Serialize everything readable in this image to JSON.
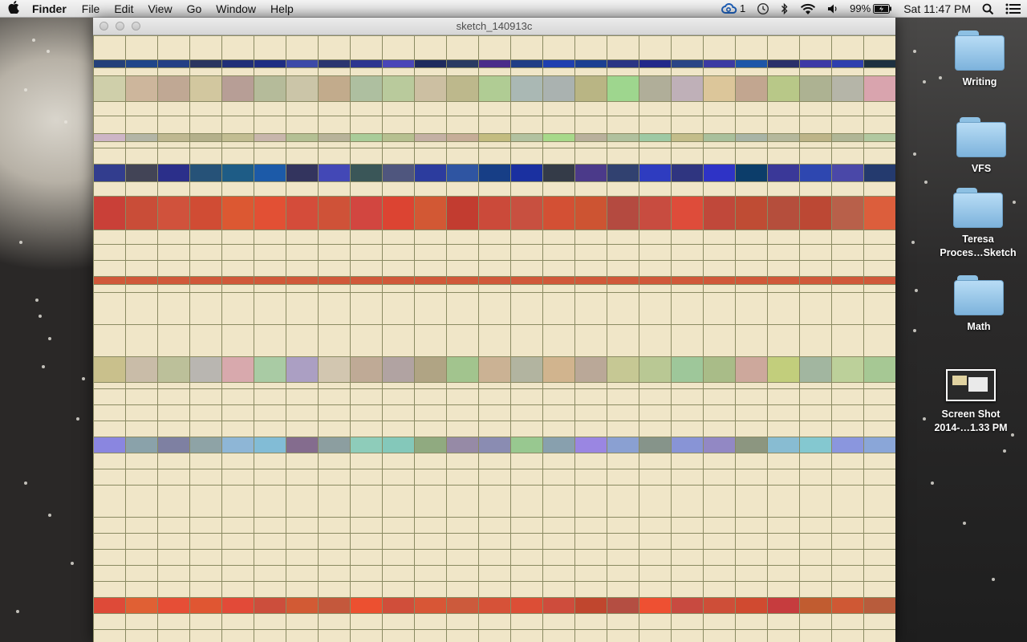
{
  "menubar": {
    "app": "Finder",
    "items": [
      "File",
      "Edit",
      "View",
      "Go",
      "Window",
      "Help"
    ],
    "cc_badge": "1",
    "battery": "99%",
    "clock": "Sat 11:47 PM"
  },
  "window": {
    "title": "sketch_140913c"
  },
  "grid": {
    "color_rows": [
      {
        "colors": [
          "#23407a",
          "#20468a",
          "#243f85",
          "#2a3560",
          "#202e78",
          "#1e2d83",
          "#3d4aa8",
          "#2b3570",
          "#2d3590",
          "#4a46b8",
          "#1e2a5e",
          "#2a3a63",
          "#4a2c8a",
          "#203d86",
          "#1f3fb0",
          "#1c3f92",
          "#2a3584",
          "#22288a",
          "#2a4586",
          "#3b3aa3",
          "#1d56a8",
          "#2a306a",
          "#3d39a6",
          "#2e3fae",
          "#1d3040"
        ]
      },
      {
        "colors": [
          "#cfcfaa",
          "#cdb69c",
          "#c0a894",
          "#d2c79f",
          "#b79e96",
          "#b5bb9a",
          "#cbc5a8",
          "#c2ab8c",
          "#aebfa0",
          "#b9ca9c",
          "#ccbfa2",
          "#bdb88c",
          "#b0cc94",
          "#aab8b4",
          "#aab2b0",
          "#b9b584",
          "#9ed68e",
          "#b0ae99",
          "#bfb0b8",
          "#dcc69a",
          "#c2a690",
          "#b8c888",
          "#adb292",
          "#b5b5a8",
          "#d9a4ae"
        ]
      },
      {
        "colors": [
          "#cdb5c6",
          "#b3b5a6",
          "#bfb891",
          "#b4b08b",
          "#c2bd92",
          "#c8b6ac",
          "#b4c094",
          "#b8b39a",
          "#a9cc99",
          "#b6c090",
          "#c4b0a4",
          "#c6ad98",
          "#c3bc80",
          "#b2c2a0",
          "#a7d98a",
          "#b9b09c",
          "#b0c19e",
          "#9ec9a4",
          "#c3bd8a",
          "#a9c09c",
          "#a8b4a6",
          "#b5b89c",
          "#bdb488",
          "#b0b696",
          "#b1c8a0"
        ]
      },
      {
        "colors": [
          "#323d8e",
          "#424456",
          "#2b2f8a",
          "#265278",
          "#1e5c86",
          "#1c5aa8",
          "#33345e",
          "#4348b6",
          "#3a5658",
          "#4f567e",
          "#2c3c9e",
          "#2f55a2",
          "#173e86",
          "#1a30a0",
          "#343b48",
          "#4b3a8a",
          "#314170",
          "#2e3cc0",
          "#2f3580",
          "#2e33c6",
          "#0c3d6a",
          "#3a3898",
          "#2e47b0",
          "#4a48a8",
          "#243a6e"
        ]
      },
      {
        "colors": [
          "#c94038",
          "#c94d38",
          "#d0523c",
          "#d04c34",
          "#dc5832",
          "#e25034",
          "#d44c3a",
          "#cf5238",
          "#d24640",
          "#dc4432",
          "#d25834",
          "#c23c30",
          "#cb4a3a",
          "#c85040",
          "#d35034",
          "#cd5432",
          "#b44a40",
          "#c84c40",
          "#de4c3a",
          "#c0483a",
          "#bf4c34",
          "#b54e3c",
          "#bc4834",
          "#b8604a",
          "#dc5e3c"
        ]
      },
      {
        "colors": [
          "#d0583a",
          "#d0583a",
          "#d0583a",
          "#d0583a",
          "#d0583a",
          "#d0583a",
          "#d0583a",
          "#d0583a",
          "#d0583a",
          "#d0583a",
          "#d0583a",
          "#d0583a",
          "#d0583a",
          "#d0583a",
          "#d0583a",
          "#d0583a",
          "#d0583a",
          "#d0583a",
          "#d0583a",
          "#d0583a",
          "#d0583a",
          "#d0583a",
          "#d0583a",
          "#d0583a",
          "#d0583a"
        ]
      },
      {
        "colors": [
          "#c9c08c",
          "#c9bca8",
          "#bcc09a",
          "#b9b6b1",
          "#d8a9ad",
          "#a9cba4",
          "#ab9fc3",
          "#d2c6b0",
          "#bfaa96",
          "#b1a3a2",
          "#b0a484",
          "#a2c48e",
          "#cbb294",
          "#b2b4a0",
          "#d1b48e",
          "#baa898",
          "#c6c894",
          "#b9c894",
          "#9ec79a",
          "#a9bc88",
          "#cda89c",
          "#c2ce7c",
          "#a2b6a0",
          "#bcd09a",
          "#a6c894"
        ]
      },
      {
        "colors": [
          "#8a86e0",
          "#8aa2aa",
          "#7e80a2",
          "#8ea3a6",
          "#8eb6d6",
          "#82bcd6",
          "#846c8e",
          "#8c9ea0",
          "#8eccba",
          "#84c8ba",
          "#90aa80",
          "#968aa6",
          "#8a8cb2",
          "#98c890",
          "#88a0ae",
          "#9a86e2",
          "#8aa0d2",
          "#86948a",
          "#8894d6",
          "#9288c4",
          "#8c9680",
          "#88bcd2",
          "#84c8d0",
          "#8a96de",
          "#8aa6d8"
        ]
      },
      {
        "colors": [
          "#de4a38",
          "#e06034",
          "#e64e36",
          "#e05632",
          "#e24a38",
          "#cc4e3c",
          "#d25a34",
          "#c4583c",
          "#ec5030",
          "#d04e3a",
          "#d85636",
          "#cc5a3c",
          "#d65238",
          "#dc4e36",
          "#ce4c3c",
          "#c0462e",
          "#b44e42",
          "#ee5032",
          "#c84a40",
          "#ce4e38",
          "#d04a30",
          "#c63c3e",
          "#c15c30",
          "#cf5834",
          "#b85c3c"
        ]
      }
    ]
  },
  "desktop": {
    "icons": [
      {
        "kind": "folder",
        "label1": "Writing",
        "label2": ""
      },
      {
        "kind": "folder",
        "label1": "VFS",
        "label2": ""
      },
      {
        "kind": "folder",
        "label1": "Teresa",
        "label2": "Proces…Sketch"
      },
      {
        "kind": "folder",
        "label1": "Math",
        "label2": ""
      },
      {
        "kind": "screenshot",
        "label1": "Screen Shot",
        "label2": "2014-…1.33 PM"
      }
    ]
  }
}
